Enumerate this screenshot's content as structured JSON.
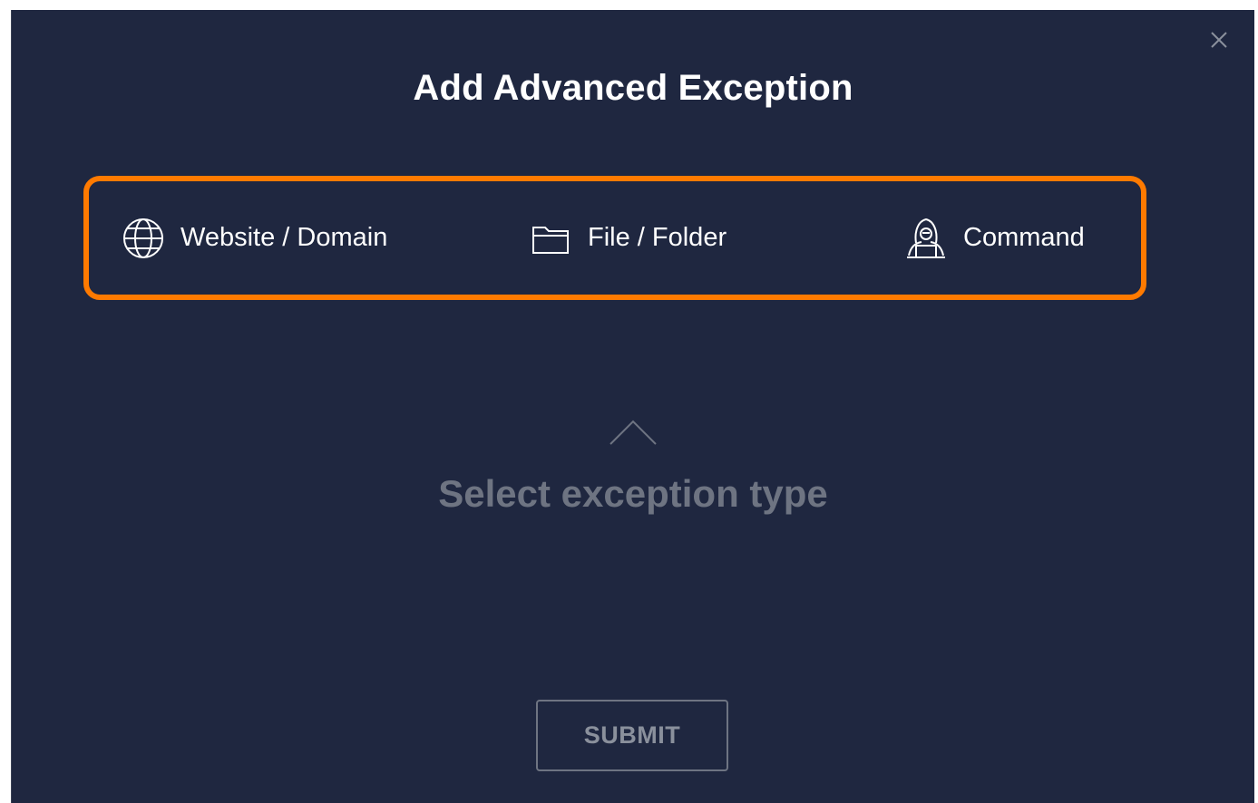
{
  "dialog": {
    "title": "Add Advanced Exception",
    "close_icon": "close-icon",
    "background_color": "#1f2740"
  },
  "exception_types": {
    "highlight_color": "#ff7a00",
    "items": [
      {
        "label": "Website / Domain",
        "icon": "globe-icon"
      },
      {
        "label": "File / Folder",
        "icon": "folder-icon"
      },
      {
        "label": "Command",
        "icon": "hacker-icon"
      }
    ]
  },
  "prompt": {
    "icon": "chevron-up-icon",
    "text": "Select exception type"
  },
  "actions": {
    "submit_label": "SUBMIT"
  }
}
